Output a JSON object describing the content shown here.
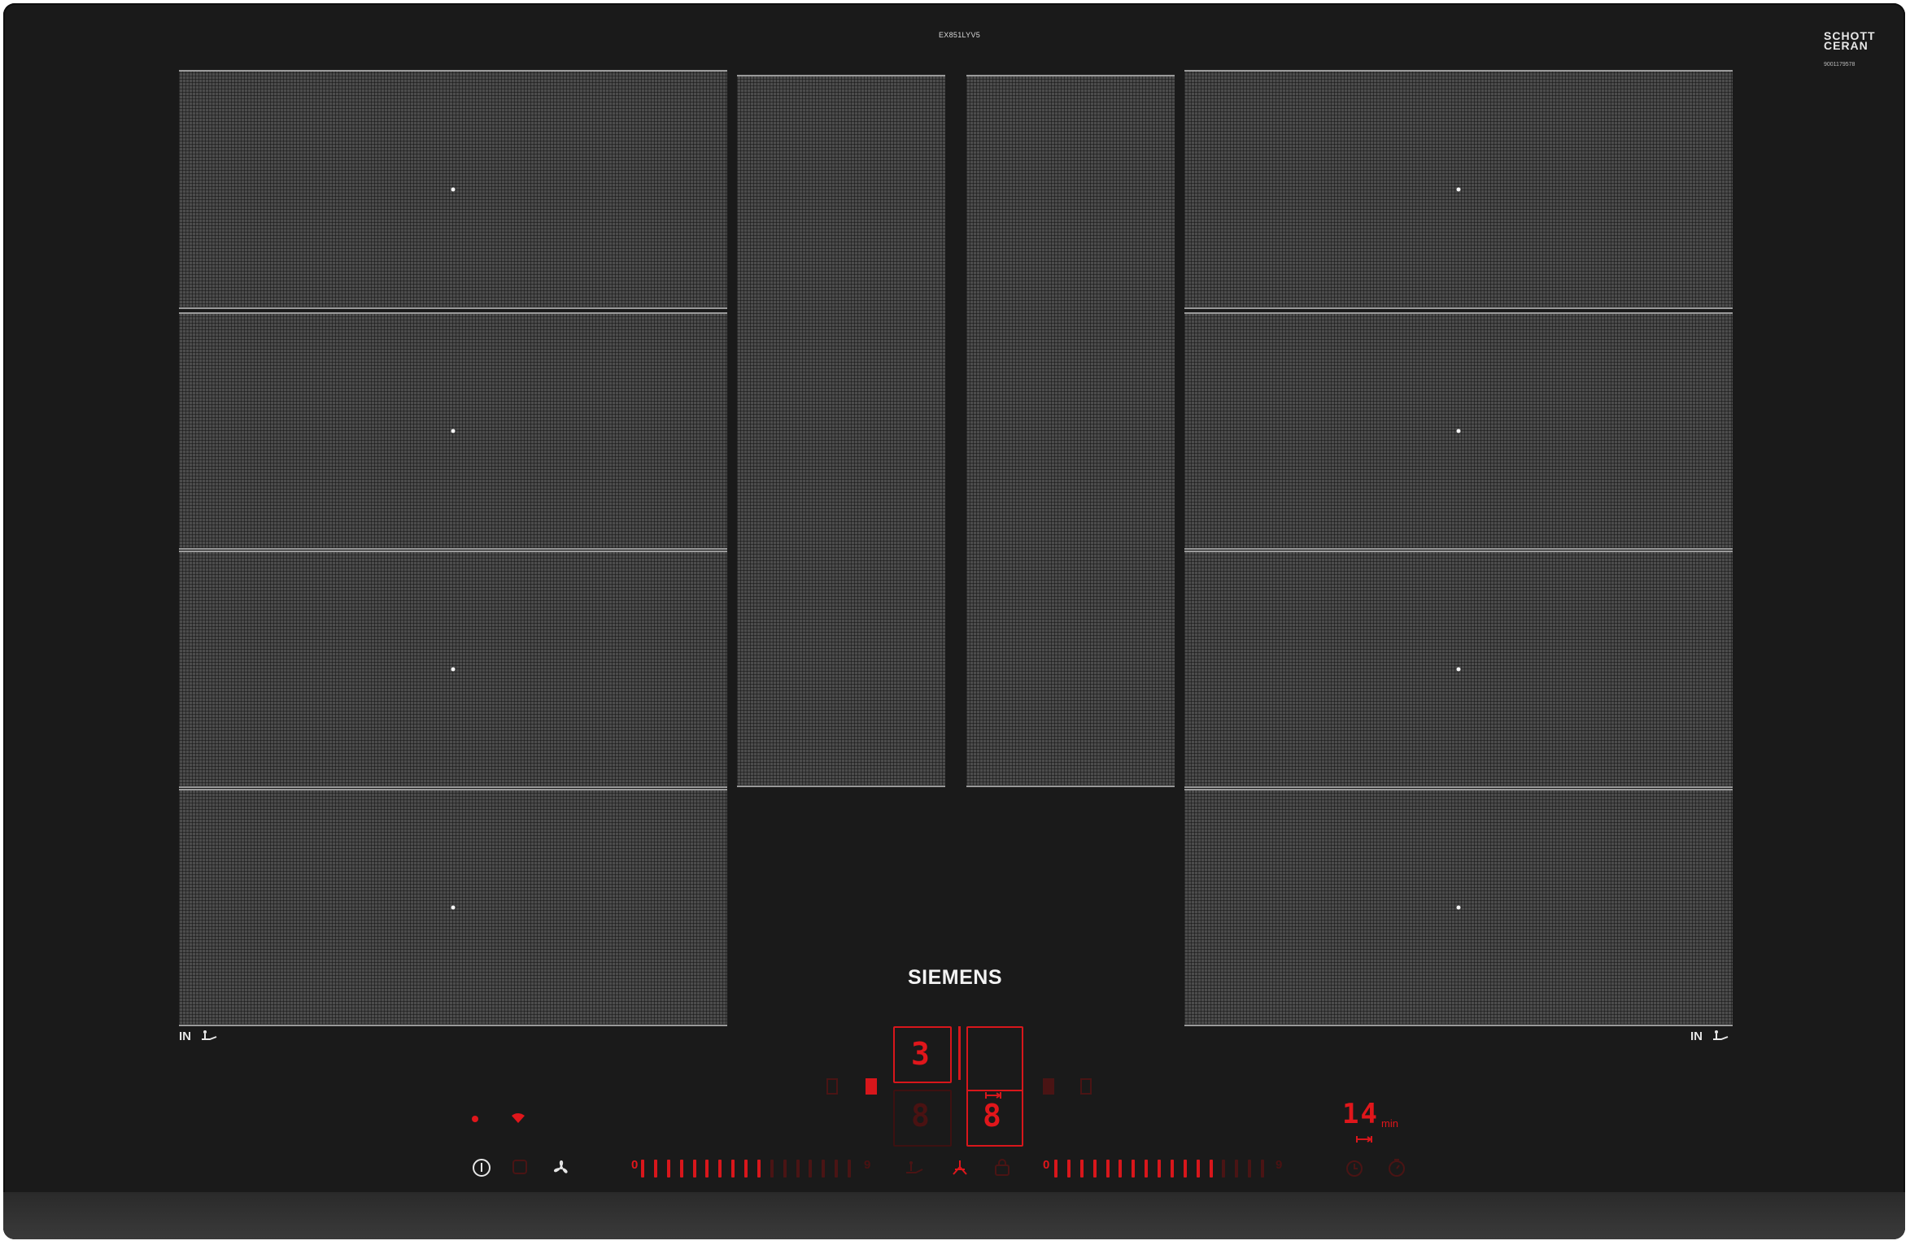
{
  "product": {
    "model_code": "EX851LYV5",
    "glass_brand_line1": "SCHOTT",
    "glass_brand_line2": "CERAN",
    "glass_code": "9001179578",
    "brand": "SIEMENS"
  },
  "zones": {
    "left_flex_label": "IN",
    "right_flex_label": "IN"
  },
  "controls": {
    "front_display_value": "3",
    "rear_display_value": "8",
    "timer_value": "14",
    "timer_unit": "min",
    "left_slider": {
      "min_label": "0",
      "max_label": "9",
      "active_level": 0.6
    },
    "right_slider": {
      "min_label": "0",
      "max_label": "9",
      "active_level": 0.75
    }
  },
  "colors": {
    "glass": "#1a1a1a",
    "zone_pattern": "#4c4c4c",
    "indicator_red": "#e0161b"
  },
  "icons": [
    "power-icon",
    "wifi-icon",
    "fan-icon",
    "flex-zone-icon",
    "lock-icon",
    "timer-icon",
    "stopwatch-icon"
  ]
}
